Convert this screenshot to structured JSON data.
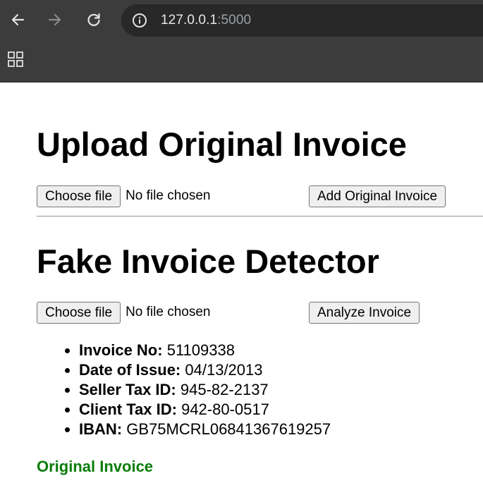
{
  "browser": {
    "url_host": "127.0.0.1",
    "url_port": ":5000",
    "icons": {
      "back": "back-arrow-icon",
      "forward": "forward-arrow-icon",
      "reload": "reload-icon",
      "info": "info-icon",
      "apps": "apps-grid-icon"
    }
  },
  "upload_section": {
    "title": "Upload Original Invoice",
    "choose_file_label": "Choose file",
    "file_status": "No file chosen",
    "submit_label": "Add Original Invoice"
  },
  "detector_section": {
    "title": "Fake Invoice Detector",
    "choose_file_label": "Choose file",
    "file_status": "No file chosen",
    "submit_label": "Analyze Invoice"
  },
  "invoice_fields": [
    {
      "label": "Invoice No:",
      "value": "51109338"
    },
    {
      "label": "Date of Issue:",
      "value": "04/13/2013"
    },
    {
      "label": "Seller Tax ID:",
      "value": "945-82-2137"
    },
    {
      "label": "Client Tax ID:",
      "value": "942-80-0517"
    },
    {
      "label": "IBAN:",
      "value": "GB75MCRL06841367619257"
    }
  ],
  "result": {
    "text": "Original Invoice",
    "color": "#0a7d0a"
  }
}
